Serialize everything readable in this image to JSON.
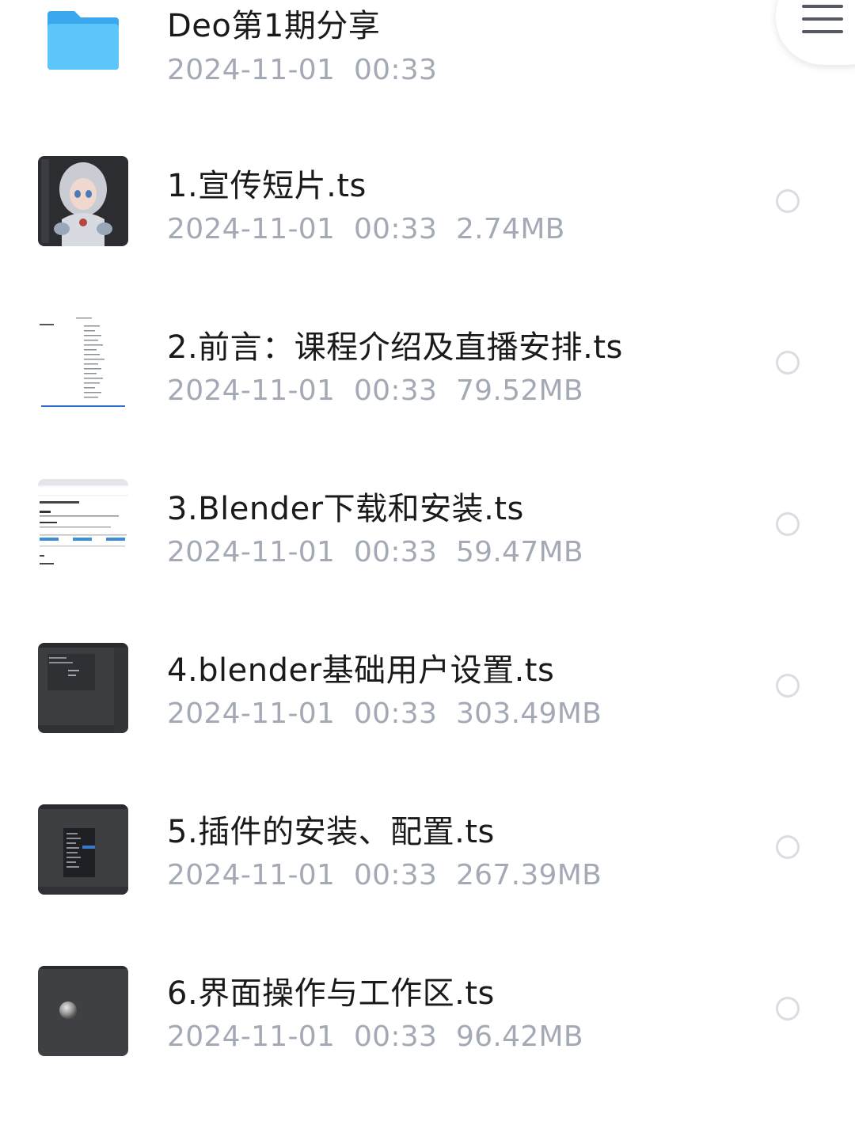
{
  "colors": {
    "title": "#1a1a1a",
    "meta": "#a3aab5",
    "radio_border": "#d9dde3",
    "folder": "#43b6f5"
  },
  "folder": {
    "name": "Deo第1期分享",
    "date": "2024-11-01",
    "time": "00:33",
    "icon": "folder-icon"
  },
  "menu_button": {
    "icon": "hamburger-menu-icon"
  },
  "files": [
    {
      "name": "1.宣传短片.ts",
      "date": "2024-11-01",
      "time": "00:33",
      "size": "2.74MB",
      "thumb": "character-render-thumbnail"
    },
    {
      "name": "2.前言：课程介绍及直播安排.ts",
      "date": "2024-11-01",
      "time": "00:33",
      "size": "79.52MB",
      "thumb": "document-thumbnail"
    },
    {
      "name": "3.Blender下载和安装.ts",
      "date": "2024-11-01",
      "time": "00:33",
      "size": "59.47MB",
      "thumb": "webpage-thumbnail"
    },
    {
      "name": "4.blender基础用户设置.ts",
      "date": "2024-11-01",
      "time": "00:33",
      "size": "303.49MB",
      "thumb": "blender-settings-thumbnail"
    },
    {
      "name": "5.插件的安装、配置.ts",
      "date": "2024-11-01",
      "time": "00:33",
      "size": "267.39MB",
      "thumb": "blender-menu-thumbnail"
    },
    {
      "name": "6.界面操作与工作区.ts",
      "date": "2024-11-01",
      "time": "00:33",
      "size": "96.42MB",
      "thumb": "blender-sphere-thumbnail"
    }
  ]
}
